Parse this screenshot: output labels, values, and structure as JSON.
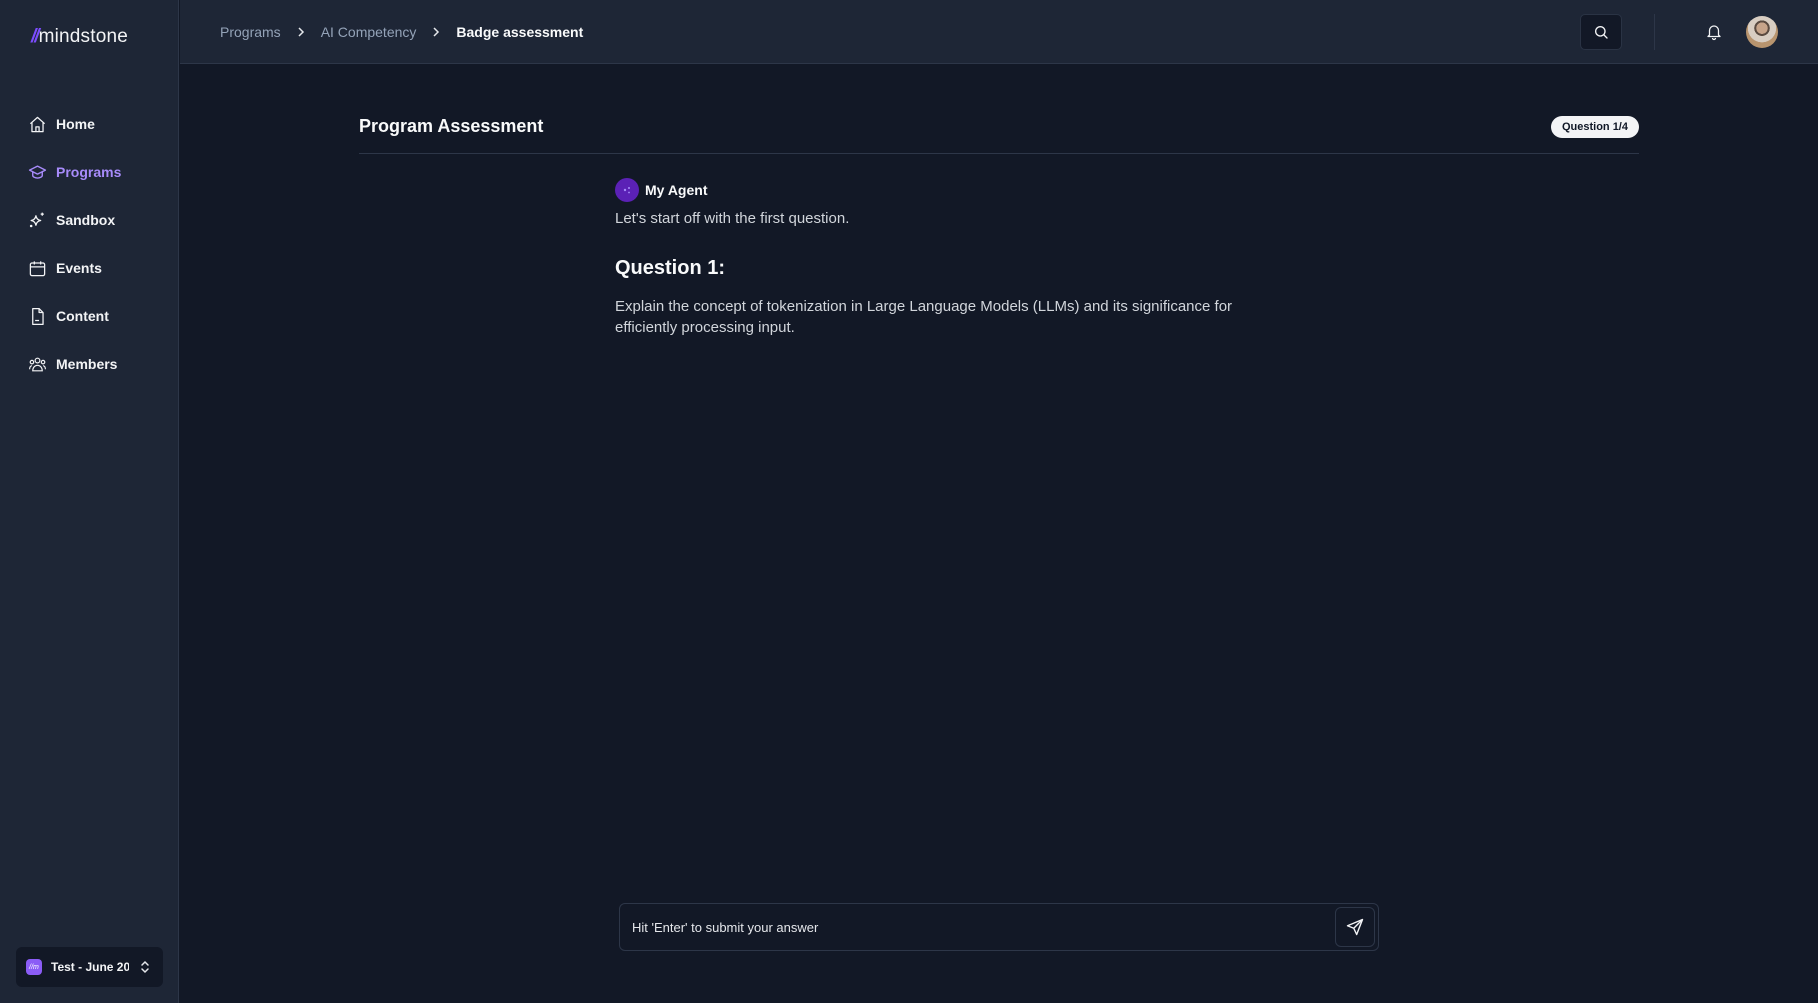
{
  "app": {
    "brand": {
      "slashes": "//",
      "name": "mindstone",
      "accent_color": "#7c4dff"
    }
  },
  "sidebar": {
    "items": [
      {
        "label": "Home",
        "icon": "home-icon",
        "active": false
      },
      {
        "label": "Programs",
        "icon": "graduation-cap-icon",
        "active": true
      },
      {
        "label": "Sandbox",
        "icon": "sparkles-icon",
        "active": false
      },
      {
        "label": "Events",
        "icon": "calendar-icon",
        "active": false
      },
      {
        "label": "Content",
        "icon": "document-icon",
        "active": false
      },
      {
        "label": "Members",
        "icon": "users-icon",
        "active": false
      }
    ],
    "workspace": {
      "badge": "//m",
      "name": "Test - June 20"
    },
    "active_color": "#a78bfa"
  },
  "header": {
    "breadcrumb": [
      "Programs",
      "AI Competency",
      "Badge assessment"
    ]
  },
  "main": {
    "title": "Program Assessment",
    "progress_badge": "Question 1/4",
    "agent": {
      "name": "My Agent"
    },
    "intro": "Let's start off with the first question.",
    "question_title": "Question 1:",
    "question_text": "Explain the concept of tokenization in Large Language Models (LLMs) and its significance for efficiently processing input."
  },
  "answer": {
    "placeholder": "Hit 'Enter' to submit your answer",
    "value": ""
  }
}
